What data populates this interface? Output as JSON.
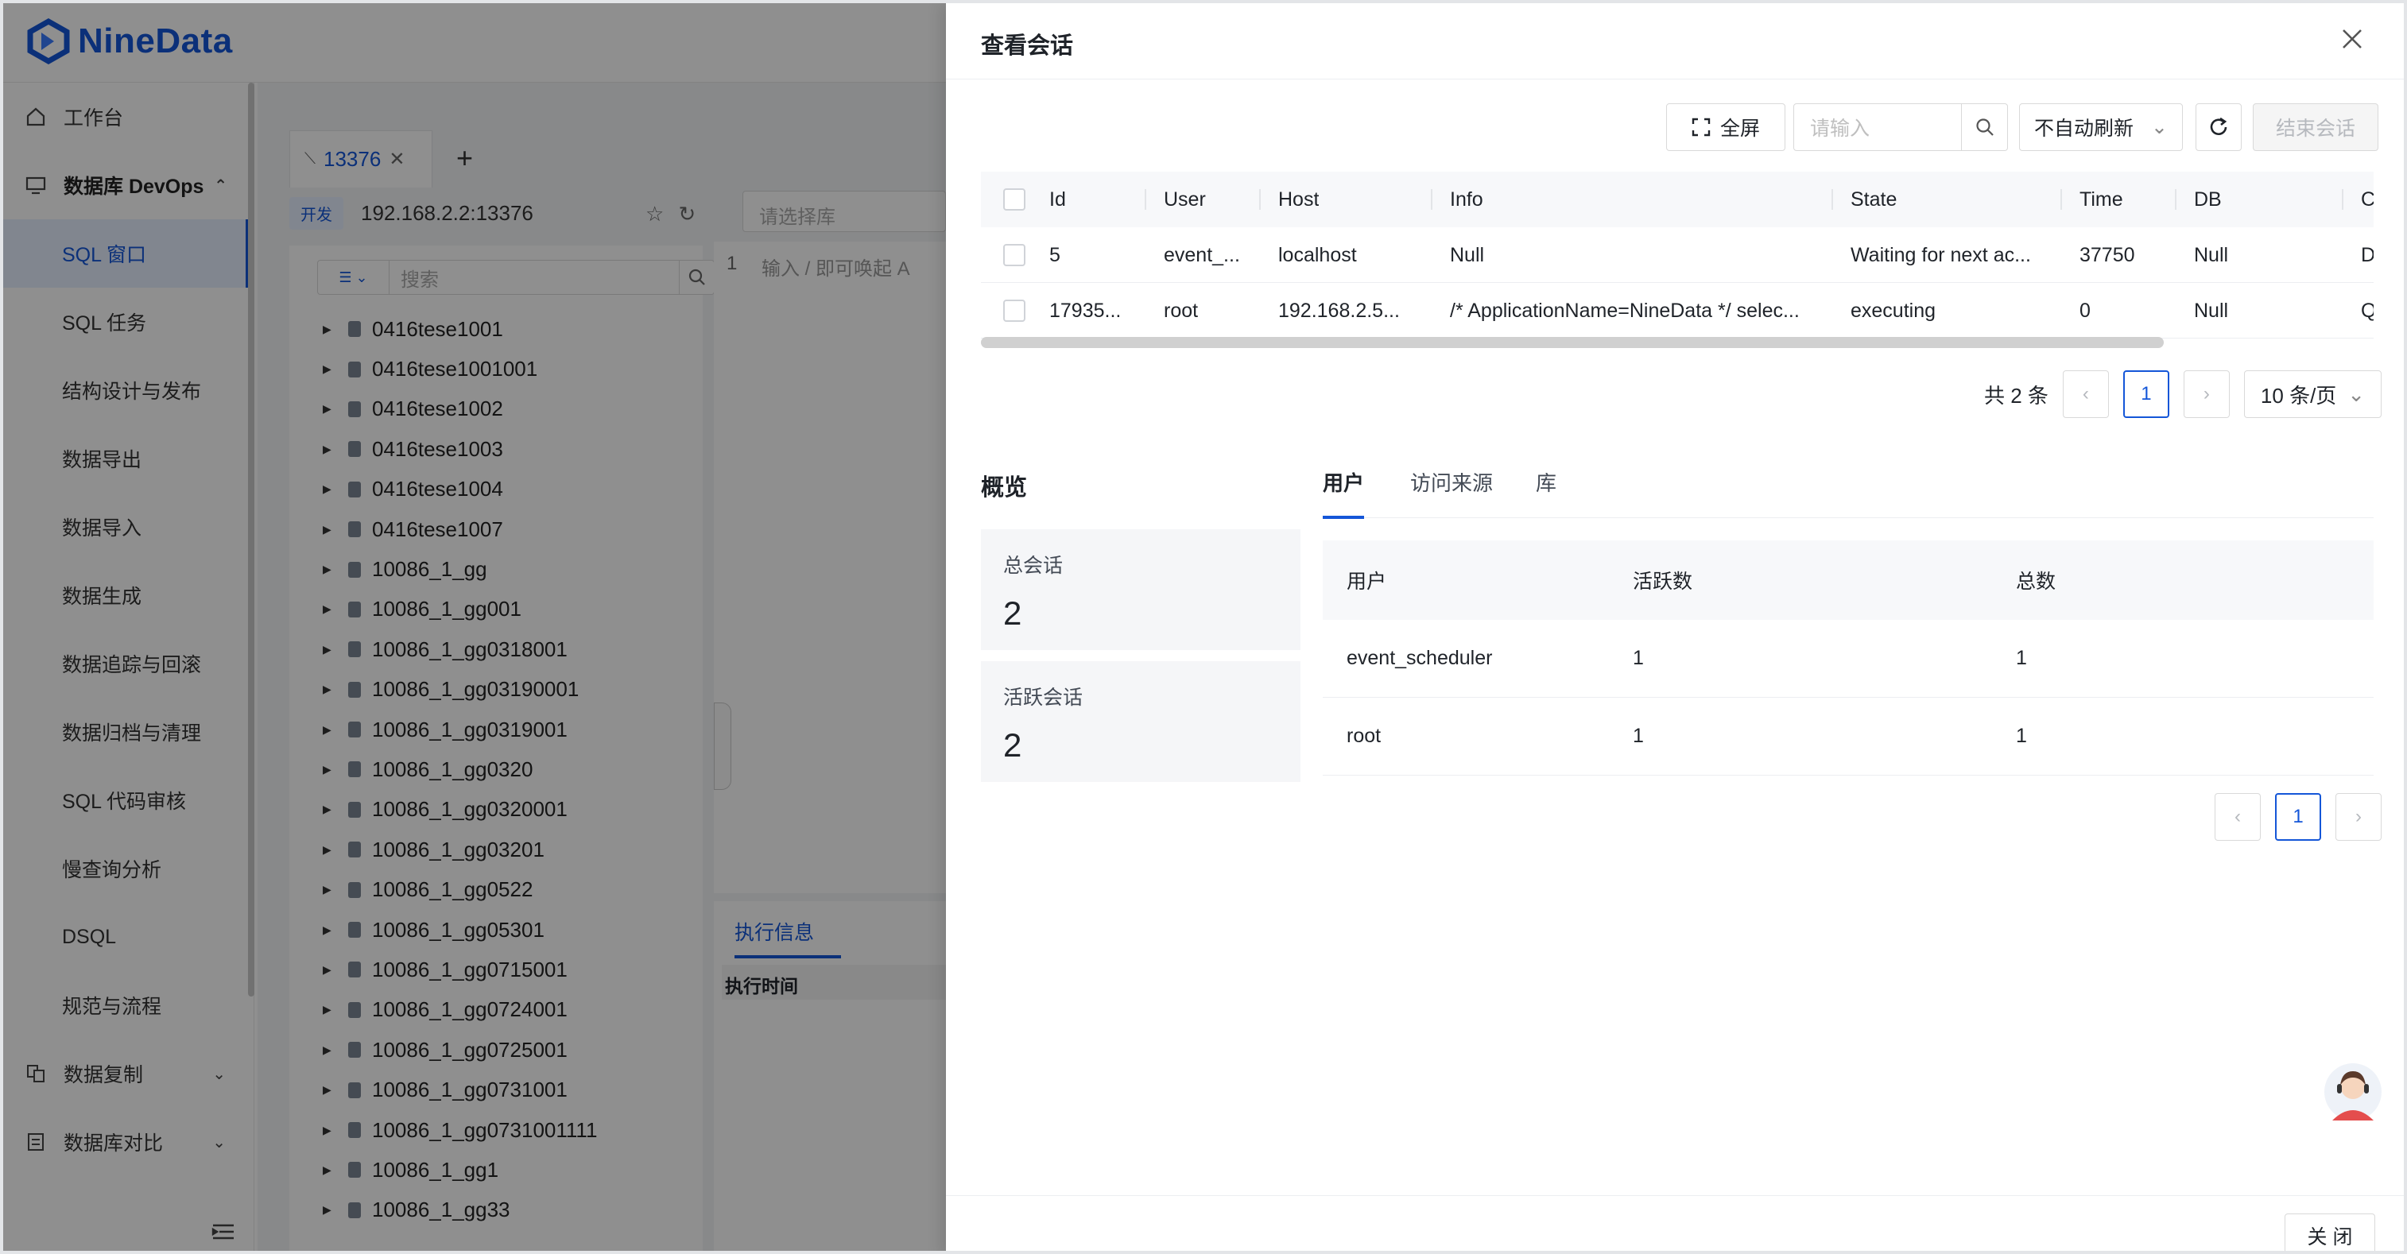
{
  "app": {
    "logo_text": "NineData",
    "sidebar": {
      "workbench": "工作台",
      "devops": "数据库 DevOps",
      "sub_items": [
        "SQL 窗口",
        "SQL 任务",
        "结构设计与发布",
        "数据导出",
        "数据导入",
        "数据生成",
        "数据追踪与回滚",
        "数据归档与清理",
        "SQL 代码审核",
        "慢查询分析",
        "DSQL",
        "规范与流程"
      ],
      "replication": "数据复制",
      "compare": "数据库对比"
    },
    "tab_label": "13376",
    "env_badge": "开发",
    "connection": "192.168.2.2:13376",
    "db_select_placeholder": "请选择库",
    "tree_search_placeholder": "搜索",
    "tree_items": [
      "0416tese1001",
      "0416tese1001001",
      "0416tese1002",
      "0416tese1003",
      "0416tese1004",
      "0416tese1007",
      "10086_1_gg",
      "10086_1_gg001",
      "10086_1_gg0318001",
      "10086_1_gg03190001",
      "10086_1_gg0319001",
      "10086_1_gg0320",
      "10086_1_gg0320001",
      "10086_1_gg03201",
      "10086_1_gg0522",
      "10086_1_gg05301",
      "10086_1_gg0715001",
      "10086_1_gg0724001",
      "10086_1_gg0725001",
      "10086_1_gg0731001",
      "10086_1_gg0731001111",
      "10086_1_gg1",
      "10086_1_gg33"
    ],
    "editor_line": "1",
    "editor_hint": "输入 / 即可唤起 A",
    "exec_tab": "执行信息",
    "exec_col": "执行时间"
  },
  "drawer": {
    "title": "查看会话",
    "toolbar": {
      "fullscreen": "全屏",
      "search_placeholder": "请输入",
      "refresh_mode": "不自动刷新",
      "end_session": "结束会话"
    },
    "session_table": {
      "columns": [
        "Id",
        "User",
        "Host",
        "Info",
        "State",
        "Time",
        "DB",
        "C"
      ],
      "rows": [
        [
          "5",
          "event_...",
          "localhost",
          "Null",
          "Waiting for next ac...",
          "37750",
          "Null",
          "D"
        ],
        [
          "17935...",
          "root",
          "192.168.2.5...",
          "/* ApplicationName=NineData */ selec...",
          "executing",
          "0",
          "Null",
          "Q"
        ]
      ]
    },
    "pagination": {
      "total": "共 2 条",
      "current": "1",
      "page_size": "10 条/页"
    },
    "overview": {
      "title": "概览",
      "total_label": "总会话",
      "total_value": "2",
      "active_label": "活跃会话",
      "active_value": "2"
    },
    "sub_tabs": [
      "用户",
      "访问来源",
      "库"
    ],
    "user_table": {
      "columns": [
        "用户",
        "活跃数",
        "总数"
      ],
      "rows": [
        [
          "event_scheduler",
          "1",
          "1"
        ],
        [
          "root",
          "1",
          "1"
        ]
      ]
    },
    "pagination2": {
      "current": "1"
    },
    "close": "关 闭"
  },
  "colors": {
    "accent": "#1456d8",
    "overlay": "rgba(0,0,0,0.44)"
  }
}
